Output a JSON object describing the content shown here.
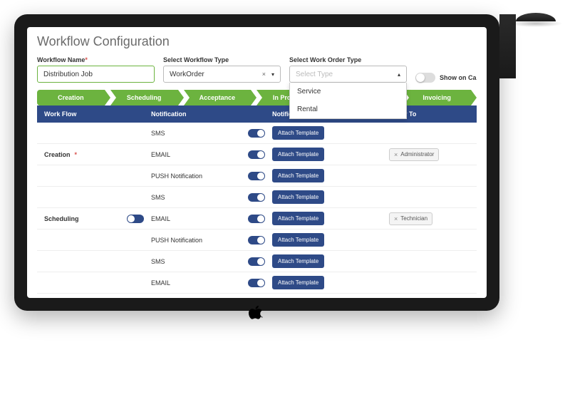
{
  "title": "Workflow Configuration",
  "fields": {
    "name_label": "Workflow Name",
    "name_value": "Distribution Job",
    "type_label": "Select Workflow Type",
    "type_value": "WorkOrder",
    "order_label": "Select Work Order Type",
    "order_placeholder": "Select Type",
    "order_options": [
      "Service",
      "Rental"
    ],
    "show_on_label": "Show on Ca"
  },
  "stages": [
    "Creation",
    "Scheduling",
    "Acceptance",
    "In Progress",
    "",
    "Invoicing"
  ],
  "table": {
    "headers": {
      "workflow": "Work Flow",
      "notification": "Notification",
      "template": "Notification Template",
      "notify": "Notify To"
    },
    "attach_label": "Attach Template",
    "rows": [
      {
        "wf": "",
        "notif": "SMS",
        "notify": ""
      },
      {
        "wf": "Creation",
        "wf_req": true,
        "notif": "EMAIL",
        "notify": "Administrator"
      },
      {
        "wf": "",
        "notif": "PUSH Notification",
        "notify": ""
      },
      {
        "wf": "",
        "notif": "SMS",
        "notify": ""
      },
      {
        "wf": "Scheduling",
        "wf_toggle": true,
        "notif": "EMAIL",
        "notify": "Technician"
      },
      {
        "wf": "",
        "notif": "PUSH Notification",
        "notify": ""
      },
      {
        "wf": "",
        "notif": "SMS",
        "notify": ""
      },
      {
        "wf": "",
        "notif": "EMAIL",
        "notify": ""
      }
    ]
  }
}
